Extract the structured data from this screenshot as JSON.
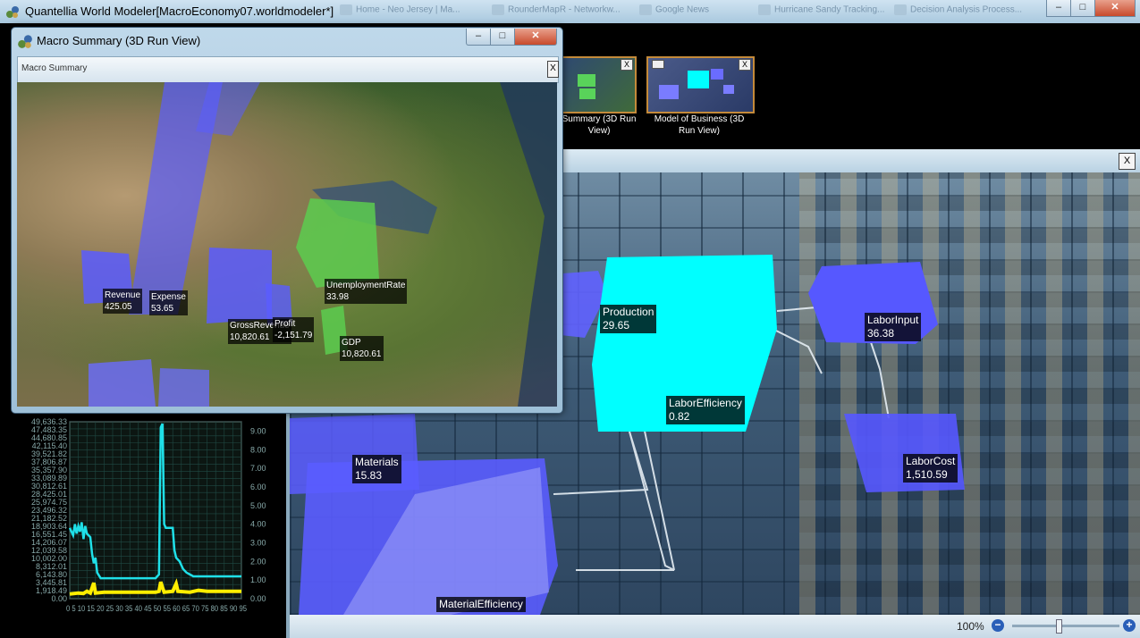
{
  "app": {
    "title": "Quantellia World Modeler[MacroEconomy07.worldmodeler*]",
    "taskbar_ghosts": [
      "Home - Neo Jersey | Ma...",
      "RounderMapR - Networkw...",
      "Google News",
      "Hurricane Sandy Tracking...",
      "Decision Analysis Process..."
    ],
    "window_controls": {
      "minimize": "–",
      "maximize": "□",
      "close": "✕"
    }
  },
  "thumbnails": [
    {
      "label": "Summary (3D Run View)"
    },
    {
      "label": "Model of Business (3D Run View)"
    }
  ],
  "close_glyph": "X",
  "float_window": {
    "title": "Macro Summary (3D Run View)",
    "inner_title": "Macro Summary",
    "controls": {
      "minimize": "–",
      "maximize": "□",
      "close": "✕"
    },
    "labels": [
      {
        "name": "Revenue",
        "value": "425.05"
      },
      {
        "name": "Expense",
        "value": "53.65"
      },
      {
        "name": "GrossRevenue",
        "value": "10,820.61"
      },
      {
        "name": "Profit",
        "value": "-2,151.79"
      },
      {
        "name": "UnemploymentRate",
        "value": "33.98"
      },
      {
        "name": "GDP",
        "value": "10,820.61"
      }
    ]
  },
  "scene": {
    "labels": [
      {
        "name": "Production",
        "value": "29.65"
      },
      {
        "name": "LaborInput",
        "value": "36.38"
      },
      {
        "name": "LaborEfficiency",
        "value": "0.82"
      },
      {
        "name": "Materials",
        "value": "15.83"
      },
      {
        "name": "LaborCost",
        "value": "1,510.59"
      },
      {
        "name": "MaterialEfficiency",
        "value": ""
      }
    ],
    "zoom": "100%",
    "zoom_slider_fraction": 0.43
  },
  "colors": {
    "cyan_series": "#1fe0e8",
    "yellow_series": "#ffee00",
    "node_blue": "#5a5cff",
    "node_cyan": "#00ffff",
    "node_green": "#4fc94a"
  },
  "chart_data": {
    "type": "line",
    "left_axis_ticks": [
      "49,636.33",
      "47,483.35",
      "44,680.85",
      "42,115.40",
      "39,521.82",
      "37,806.87",
      "35,357.90",
      "33,089.89",
      "30,812.61",
      "28,425.01",
      "25,974.75",
      "23,496.32",
      "21,182.52",
      "18,903.64",
      "16,551.45",
      "14,206.07",
      "12,039.58",
      "10,002.00",
      "8,312.01",
      "6,143.80",
      "3,445.81",
      "1,918.49",
      "0.00"
    ],
    "right_axis_ticks": [
      "9.00",
      "8.00",
      "7.00",
      "6.00",
      "5.00",
      "4.00",
      "3.00",
      "2.00",
      "1.00",
      "0.00"
    ],
    "x_tick_text": "0 5 10 15 20 25 30 35 40 45 50 55 60 65 70 75 80 85 90 95",
    "right_ylim": [
      0,
      9.5
    ],
    "x_range": [
      0,
      100
    ],
    "grid": true,
    "series": [
      {
        "values": [
          [
            0,
            3.8
          ],
          [
            2,
            3.4
          ],
          [
            3,
            4.0
          ],
          [
            4,
            3.5
          ],
          [
            5,
            3.9
          ],
          [
            6,
            3.6
          ],
          [
            7,
            4.1
          ],
          [
            8,
            3.2
          ],
          [
            9,
            3.9
          ],
          [
            10,
            3.5
          ],
          [
            12,
            3.3
          ],
          [
            13,
            2.4
          ],
          [
            14,
            1.9
          ],
          [
            15,
            2.2
          ],
          [
            16,
            1.4
          ],
          [
            18,
            1.1
          ],
          [
            30,
            1.1
          ],
          [
            44,
            1.1
          ],
          [
            50,
            1.1
          ],
          [
            52,
            1.3
          ],
          [
            53,
            9.2
          ],
          [
            54,
            9.4
          ],
          [
            55,
            4.0
          ],
          [
            56,
            3.8
          ],
          [
            60,
            3.8
          ],
          [
            61,
            2.6
          ],
          [
            62,
            2.2
          ],
          [
            64,
            2.0
          ],
          [
            66,
            1.6
          ],
          [
            68,
            1.4
          ],
          [
            70,
            1.3
          ],
          [
            72,
            1.2
          ],
          [
            80,
            1.2
          ],
          [
            100,
            1.2
          ]
        ]
      },
      {
        "values": [
          [
            0,
            0.25
          ],
          [
            5,
            0.3
          ],
          [
            8,
            0.28
          ],
          [
            10,
            0.4
          ],
          [
            12,
            0.3
          ],
          [
            14,
            0.85
          ],
          [
            15,
            0.3
          ],
          [
            20,
            0.35
          ],
          [
            30,
            0.35
          ],
          [
            40,
            0.35
          ],
          [
            50,
            0.35
          ],
          [
            52,
            0.4
          ],
          [
            53,
            0.9
          ],
          [
            54,
            0.6
          ],
          [
            55,
            0.35
          ],
          [
            60,
            0.4
          ],
          [
            62,
            0.8
          ],
          [
            63,
            0.4
          ],
          [
            70,
            0.35
          ],
          [
            75,
            0.45
          ],
          [
            80,
            0.4
          ],
          [
            100,
            0.4
          ]
        ]
      }
    ]
  }
}
